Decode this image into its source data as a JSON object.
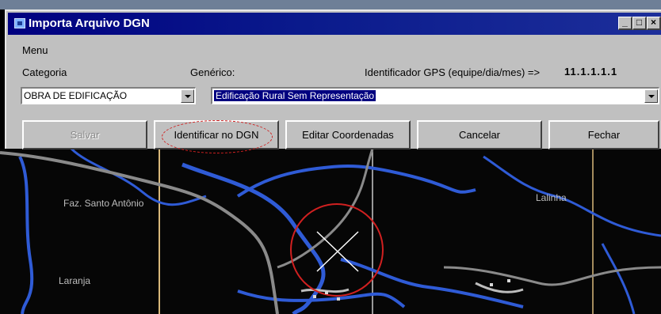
{
  "window": {
    "title": "Importa Arquivo DGN"
  },
  "menu": {
    "label": "Menu"
  },
  "fields": {
    "categoria_label": "Categoria",
    "categoria_value": "OBRA DE EDIFICAÇÃO",
    "generico_label": "Genérico:",
    "generico_value": "Edificação Rural Sem Representação",
    "gps_label": "Identificador GPS (equipe/dia/mes) =>",
    "gps_value": "11.1.1.1.1"
  },
  "buttons": {
    "salvar": "Salvar",
    "identificar": "Identificar no DGN",
    "editar": "Editar Coordenadas",
    "cancelar": "Cancelar",
    "fechar": "Fechar"
  },
  "map": {
    "labels": [
      "Faz. Santo Antônio",
      "Laranja",
      "Lalinha"
    ]
  },
  "colors": {
    "titlebar": "#000080",
    "river": "#2f5bd6",
    "road": "#8a8a8a",
    "highlight_circle": "#d02020"
  },
  "icons": [
    "app-icon",
    "minimize-icon",
    "maximize-icon",
    "close-icon",
    "dropdown-arrow-icon",
    "crosshair-icon"
  ]
}
